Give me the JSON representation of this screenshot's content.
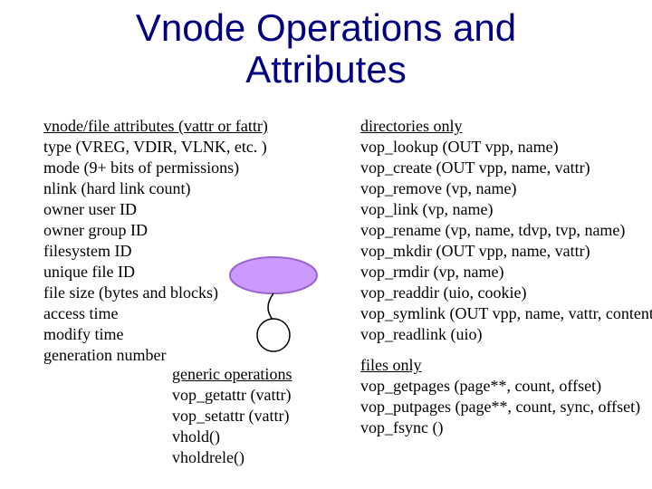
{
  "title_line1": "Vnode Operations and",
  "title_line2": "Attributes",
  "attrs": {
    "hdr": "vnode/file attributes (vattr or fattr)",
    "lines": [
      "type (VREG, VDIR, VLNK, etc. )",
      "mode (9+ bits of permissions)",
      "nlink (hard link count)",
      "owner user ID",
      "owner group ID",
      "filesystem ID",
      "unique file ID",
      "file size (bytes and blocks)",
      "access time",
      "modify time",
      "generation number"
    ]
  },
  "generic": {
    "hdr": "generic operations",
    "lines": [
      "vop_getattr  (vattr)",
      "vop_setattr (vattr)",
      "vhold()",
      "vholdrele()"
    ]
  },
  "dirs": {
    "hdr": "directories only",
    "lines": [
      "vop_lookup (OUT vpp, name)",
      "vop_create (OUT vpp, name, vattr)",
      "vop_remove (vp, name)",
      "vop_link (vp, name)",
      "vop_rename (vp, name, tdvp, tvp, name)",
      "vop_mkdir (OUT vpp, name, vattr)",
      "vop_rmdir (vp, name)",
      "vop_readdir (uio, cookie)",
      "vop_symlink (OUT vpp, name, vattr, contents)",
      "vop_readlink (uio)"
    ]
  },
  "files": {
    "hdr": "files only",
    "lines": [
      "vop_getpages (page**, count, offset)",
      "vop_putpages (page**, count, sync, offset)",
      "vop_fsync ()"
    ]
  }
}
